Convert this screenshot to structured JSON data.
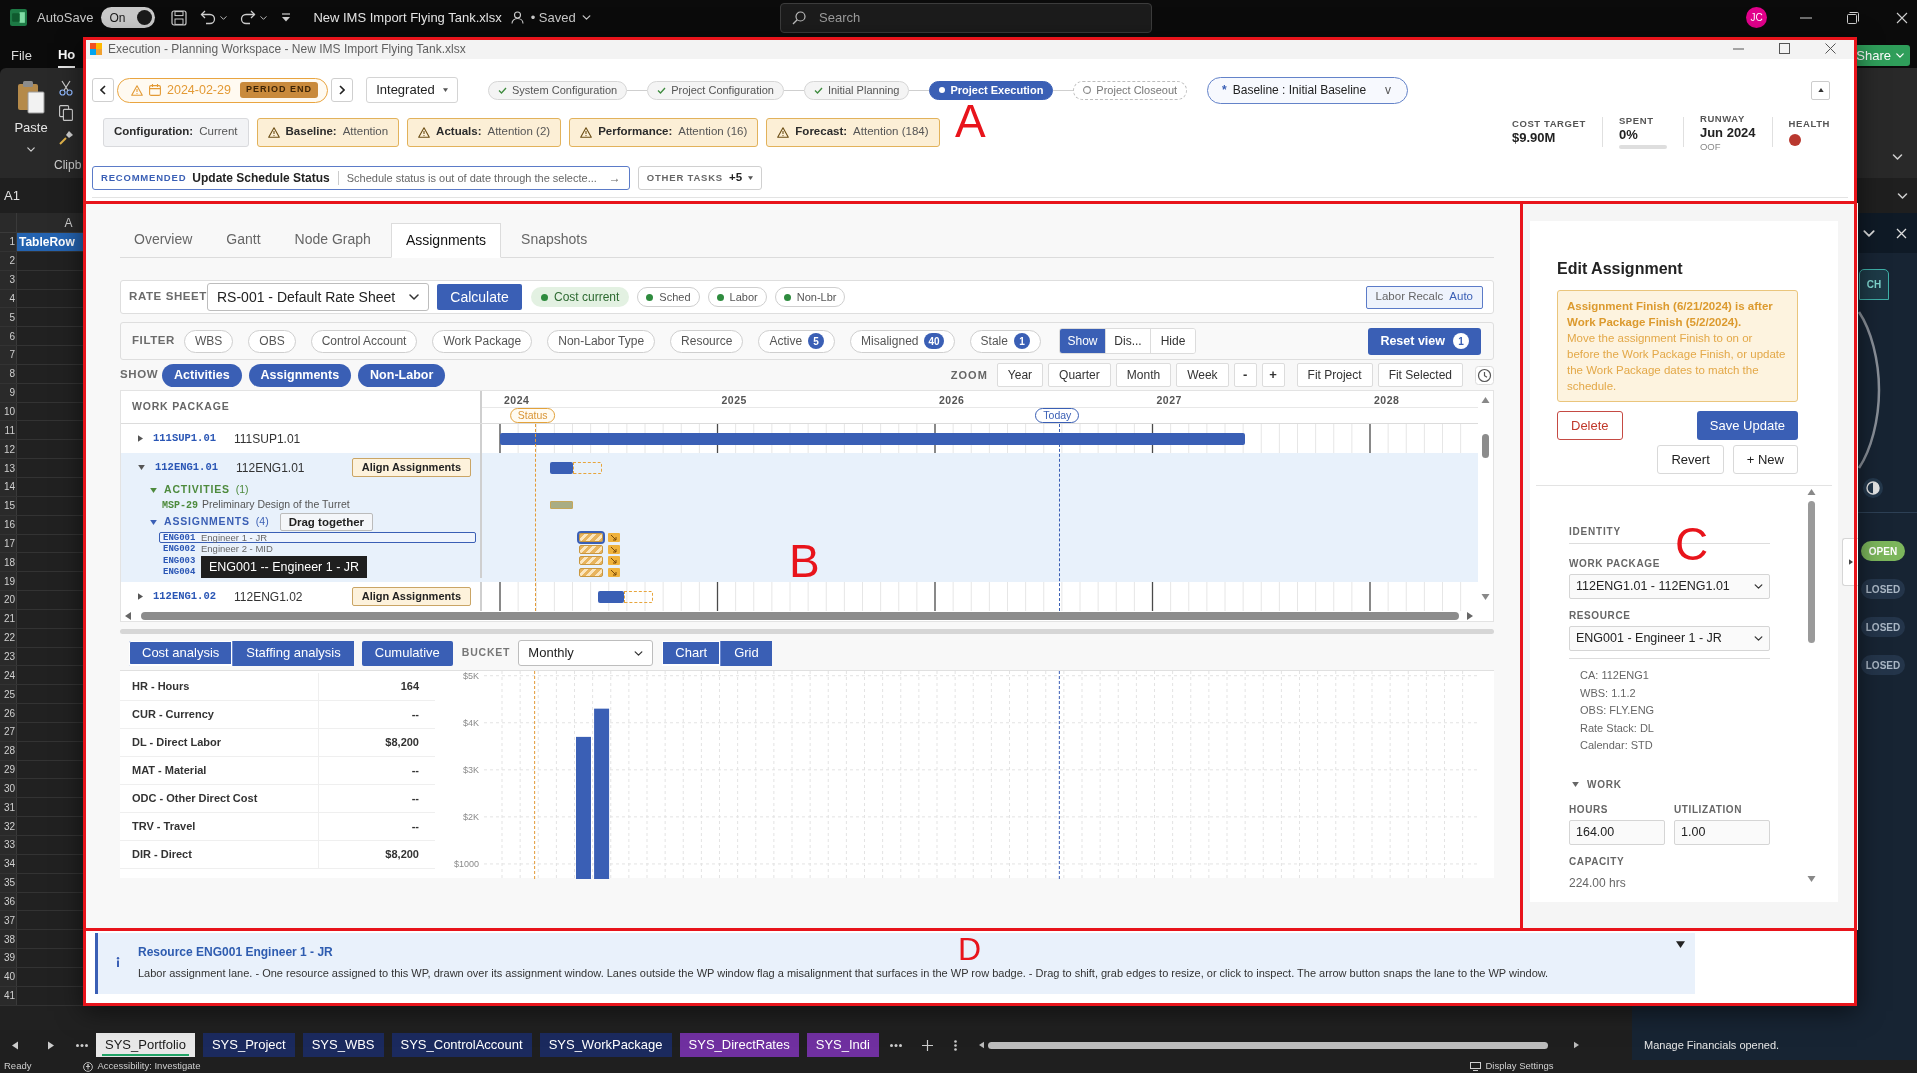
{
  "excel": {
    "title_bar": {
      "autosave": "AutoSave",
      "autosave_toggle": {
        "label": "On",
        "on": true
      },
      "file_name": "New IMS Import Flying Tank.xlsx",
      "save_state": "• Saved",
      "search": {
        "placeholder": "Search"
      },
      "avatar": "JC"
    },
    "ribbon": {
      "tabs": [
        {
          "label": "File",
          "selected": false
        },
        {
          "label": "Ho",
          "selected": true
        }
      ],
      "paste": "Paste",
      "group": "Clipb",
      "share": "Share"
    },
    "name_box": "A1",
    "column_header": "A",
    "first_cell": "TableRow",
    "row_numbers": [
      "1",
      "2",
      "3",
      "4",
      "5",
      "6",
      "7",
      "8",
      "9",
      "10",
      "11",
      "12",
      "13",
      "14",
      "15",
      "16",
      "17",
      "18",
      "19",
      "20",
      "21",
      "22",
      "23",
      "24",
      "25",
      "26",
      "27",
      "28",
      "29",
      "30",
      "31",
      "32",
      "33",
      "34",
      "35",
      "36",
      "37",
      "38",
      "39",
      "40",
      "41"
    ],
    "side_pane": {
      "tab": "CH",
      "statuses": [
        {
          "label": "OPEN",
          "kind": "open"
        },
        {
          "label": "LOSED",
          "kind": "closed"
        },
        {
          "label": "LOSED",
          "kind": "closed"
        },
        {
          "label": "LOSED",
          "kind": "closed"
        }
      ],
      "message": "Manage Financials opened."
    },
    "sheet_tabs": [
      {
        "label": "SYS_Portfolio",
        "selected": true,
        "color": "#21a366"
      },
      {
        "label": "SYS_Project",
        "selected": false,
        "color": "#1b2a5e"
      },
      {
        "label": "SYS_WBS",
        "selected": false,
        "color": "#1b2a5e"
      },
      {
        "label": "SYS_ControlAccount",
        "selected": false,
        "color": "#1b2a5e"
      },
      {
        "label": "SYS_WorkPackage",
        "selected": false,
        "color": "#1b2a5e"
      },
      {
        "label": "SYS_DirectRates",
        "selected": false,
        "color": "#7030a0"
      },
      {
        "label": "SYS_Indi",
        "selected": false,
        "color": "#7030a0"
      }
    ],
    "status_bar": {
      "left": [
        "Ready",
        "Accessibility: Investigate"
      ],
      "right": "Display Settings"
    }
  },
  "dialog": {
    "title": "Execution - Planning Workspace - New IMS Import Flying Tank.xlsx",
    "header": {
      "period": {
        "date": "2024-02-29",
        "badge": "PERIOD END"
      },
      "mode": "Integrated",
      "phases": [
        {
          "label": "System Configuration",
          "kind": "done"
        },
        {
          "label": "Project Configuration",
          "kind": "done"
        },
        {
          "label": "Initial Planning",
          "kind": "done"
        },
        {
          "label": "Project Execution",
          "kind": "current"
        },
        {
          "label": "Project Closeout",
          "kind": "pending"
        }
      ],
      "baseline": {
        "marker": "*",
        "label": "Baseline : Initial Baseline",
        "caret": "v"
      },
      "health_checks": [
        {
          "label": "Configuration:",
          "value": "Current",
          "kind": "ok"
        },
        {
          "label": "Baseline:",
          "value": "Attention",
          "kind": "warning"
        },
        {
          "label": "Actuals:",
          "value": "Attention (2)",
          "kind": "warning"
        },
        {
          "label": "Performance:",
          "value": "Attention (16)",
          "kind": "warning"
        },
        {
          "label": "Forecast:",
          "value": "Attention (184)",
          "kind": "warning"
        }
      ],
      "metrics": [
        {
          "kind": "value",
          "label": "COST TARGET",
          "value": "$9.90M"
        },
        {
          "kind": "progress",
          "label": "SPENT",
          "value": "0%",
          "level": 0
        },
        {
          "kind": "value",
          "label": "RUNWAY",
          "value": "Jun 2024",
          "note": "OOF"
        },
        {
          "kind": "dot",
          "label": "HEALTH",
          "color": "#b9382f"
        }
      ],
      "recommended": {
        "tag": "RECOMMENDED",
        "title": "Update Schedule Status",
        "text": "Schedule status is out of date through the selecte...",
        "arrow": "→"
      },
      "other_tasks": {
        "label": "OTHER TASKS",
        "count": "+5"
      }
    },
    "workspace": {
      "tabs": [
        {
          "label": "Overview",
          "selected": false
        },
        {
          "label": "Gantt",
          "selected": false
        },
        {
          "label": "Node Graph",
          "selected": false
        },
        {
          "label": "Assignments",
          "selected": true
        },
        {
          "label": "Snapshots",
          "selected": false
        }
      ],
      "rate_sheet": {
        "label": "RATE SHEET",
        "value": "RS-001 - Default Rate Sheet",
        "action": "Calculate",
        "indicators": [
          {
            "label": "Cost current",
            "highlighted": true
          },
          {
            "label": "Sched",
            "highlighted": false
          },
          {
            "label": "Labor",
            "highlighted": false
          },
          {
            "label": "Non-Lbr",
            "highlighted": false
          }
        ],
        "recalc": {
          "label": "Labor Recalc",
          "value": "Auto"
        }
      },
      "filters": {
        "label": "FILTER",
        "chips": [
          {
            "label": "WBS"
          },
          {
            "label": "OBS"
          },
          {
            "label": "Control Account"
          },
          {
            "label": "Work Package"
          },
          {
            "label": "Non-Labor Type"
          },
          {
            "label": "Resource"
          },
          {
            "label": "Active",
            "count": "5"
          },
          {
            "label": "Misaligned",
            "count": "40"
          },
          {
            "label": "Stale",
            "count": "1"
          }
        ],
        "display": [
          {
            "label": "Show",
            "selected": true
          },
          {
            "label": "Dis...",
            "selected": false
          },
          {
            "label": "Hide",
            "selected": false
          }
        ],
        "reset": {
          "label": "Reset view",
          "count": "1"
        }
      },
      "show": {
        "label": "SHOW",
        "toggles": [
          {
            "label": "Activities",
            "on": true
          },
          {
            "label": "Assignments",
            "on": true
          },
          {
            "label": "Non-Labor",
            "on": true
          }
        ],
        "zoom_label": "ZOOM",
        "zoom": [
          "Year",
          "Quarter",
          "Month",
          "Week"
        ],
        "steps": [
          "-",
          "+"
        ],
        "fit": [
          "Fit Project",
          "Fit Selected"
        ]
      },
      "gantt": {
        "column_header": "WORK PACKAGE",
        "years": [
          "2024",
          "2025",
          "2026",
          "2027",
          "2028"
        ],
        "status_marker": "Status",
        "today_marker": "Today",
        "rows": [
          {
            "code": "111SUP1.01",
            "name": "111SUP1.01",
            "expanded": false,
            "misaligned": false
          },
          {
            "code": "112ENG1.01",
            "name": "112ENG1.01",
            "expanded": true,
            "misaligned": true,
            "action": "Align Assignments",
            "activities": {
              "label": "ACTIVITIES",
              "count": "(1)",
              "expanded": true,
              "items": [
                {
                  "code": "MSP-29",
                  "name": "Preliminary Design of the Turret"
                }
              ]
            },
            "assignments": {
              "label": "ASSIGNMENTS",
              "count": "(4)",
              "expanded": true,
              "action": "Drag together",
              "items": [
                {
                  "code": "ENG001",
                  "name": "Engineer 1 - JR",
                  "selected": true
                },
                {
                  "code": "ENG002",
                  "name": "Engineer 2 - MID",
                  "selected": false
                },
                {
                  "code": "ENG003",
                  "selected": false
                },
                {
                  "code": "ENG004",
                  "selected": false
                }
              ],
              "tooltip": "ENG001 -- Engineer 1 - JR"
            }
          },
          {
            "code": "112ENG1.02",
            "name": "112ENG1.02",
            "expanded": false,
            "misaligned": true,
            "action": "Align Assignments"
          }
        ]
      },
      "analysis": {
        "views": [
          {
            "label": "Cost analysis",
            "selected": true
          },
          {
            "label": "Staffing analysis",
            "selected": false
          }
        ],
        "cumulative": {
          "label": "Cumulative",
          "on": true
        },
        "bucket_label": "BUCKET",
        "bucket": "Monthly",
        "modes": [
          {
            "label": "Chart",
            "selected": true
          },
          {
            "label": "Grid",
            "selected": false
          }
        ],
        "rows": [
          {
            "label": "HR - Hours",
            "value": "164"
          },
          {
            "label": "CUR - Currency",
            "value": "--"
          },
          {
            "label": "DL - Direct Labor",
            "value": "$8,200"
          },
          {
            "label": "MAT - Material",
            "value": "--"
          },
          {
            "label": "ODC - Other Direct Cost",
            "value": "--"
          },
          {
            "label": "TRV - Travel",
            "value": "--"
          },
          {
            "label": "DIR - Direct",
            "value": "$8,200"
          }
        ],
        "chart_data": {
          "type": "bar",
          "values": [
            null,
            null,
            null,
            null,
            null,
            3700,
            4300,
            null,
            null,
            null,
            null,
            null,
            null,
            null,
            null,
            null,
            null,
            null,
            null,
            null,
            null,
            null,
            null,
            null,
            null,
            null,
            null,
            null,
            null,
            null,
            null,
            null,
            null,
            null,
            null,
            null,
            null,
            null,
            null,
            null,
            null,
            null,
            null,
            null,
            null,
            null,
            null,
            null,
            null,
            null,
            null,
            null,
            null,
            null,
            null
          ],
          "grid": true,
          "ylim": [
            680,
            5100
          ],
          "yticks": [
            {
              "value": 1000,
              "label": "$1000"
            },
            {
              "value": 2000,
              "label": "$2K"
            },
            {
              "value": 3000,
              "label": "$3K"
            },
            {
              "value": 4000,
              "label": "$4K"
            },
            {
              "value": 5000,
              "label": "$5K"
            }
          ]
        }
      }
    },
    "editor": {
      "title": "Edit Assignment",
      "warning": {
        "headline": "Assignment Finish (6/21/2024) is after Work Package Finish (5/2/2024).",
        "body": "Move the assignment Finish to on or before the Work Package Finish, or update the Work Package dates to match the schedule."
      },
      "actions": [
        {
          "label": "Delete",
          "kind": "danger"
        },
        {
          "label": "Save Update",
          "kind": "primary"
        },
        {
          "label": "Revert",
          "kind": "secondary"
        },
        {
          "label": "+ New",
          "kind": "secondary"
        }
      ],
      "identity": {
        "heading": "IDENTITY",
        "fields": [
          {
            "label": "WORK PACKAGE",
            "value": "112ENG1.01 - 112ENG1.01"
          },
          {
            "label": "RESOURCE",
            "value": "ENG001 - Engineer 1 - JR"
          }
        ],
        "details": [
          "CA: 112ENG1",
          "WBS: 1.1.2",
          "OBS: FLY.ENG",
          "Rate Stack: DL",
          "Calendar: STD"
        ]
      },
      "work": {
        "heading": "WORK",
        "expanded": true,
        "fields": [
          {
            "label": "HOURS",
            "value": "164.00"
          },
          {
            "label": "UTILIZATION",
            "value": "1.00"
          }
        ],
        "capacity_label": "CAPACITY",
        "capacity": "224.00 hrs"
      }
    },
    "info": {
      "title": "Resource ENG001 Engineer 1 - JR",
      "text": "Labor assignment lane. - One resource assigned to this WP, drawn over its assignment window. Lanes outside the WP window flag a misalignment that surfaces in the WP row badge. - Drag to shift, grab edges to resize, or click to inspect. The arrow button snaps the lane to the WP window."
    }
  },
  "annotations": [
    {
      "label": "A"
    },
    {
      "label": "B"
    },
    {
      "label": "C"
    },
    {
      "label": "D"
    }
  ]
}
